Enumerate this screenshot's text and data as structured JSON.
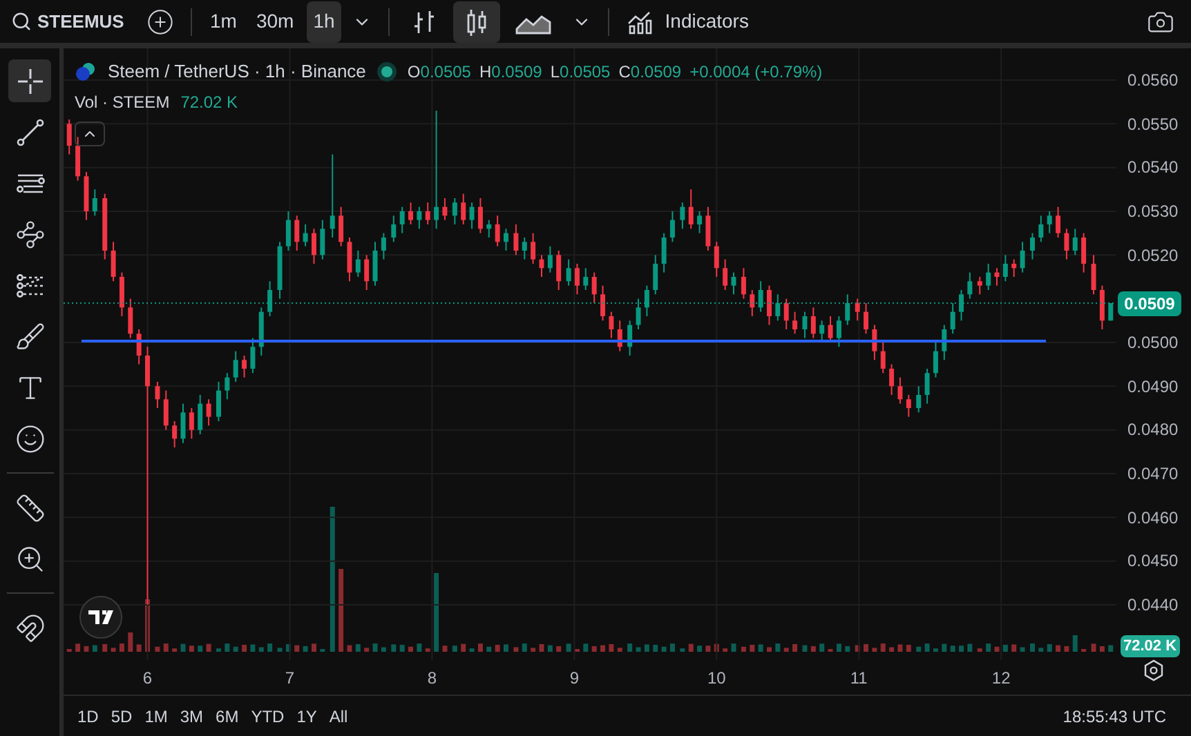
{
  "toolbar": {
    "symbol": "STEEMUS",
    "intervals": [
      {
        "label": "1m",
        "selected": false
      },
      {
        "label": "30m",
        "selected": false
      },
      {
        "label": "1h",
        "selected": true
      }
    ],
    "chart_styles": [
      {
        "kind": "bars",
        "selected": false
      },
      {
        "kind": "candles",
        "selected": true
      },
      {
        "kind": "area",
        "selected": false
      }
    ],
    "indicators_label": "Indicators"
  },
  "drawing_tools": [
    [
      {
        "kind": "crosshair",
        "selected": true
      },
      {
        "kind": "trend-line",
        "selected": false
      },
      {
        "kind": "fib",
        "selected": false
      },
      {
        "kind": "pattern",
        "selected": false
      },
      {
        "kind": "projection",
        "selected": false
      },
      {
        "kind": "brush",
        "selected": false
      },
      {
        "kind": "text",
        "selected": false
      },
      {
        "kind": "emoji",
        "selected": false
      }
    ],
    [
      {
        "kind": "ruler",
        "selected": false
      },
      {
        "kind": "zoom",
        "selected": false
      }
    ],
    [
      {
        "kind": "magnet",
        "selected": false
      }
    ]
  ],
  "legend": {
    "title": "Steem / TetherUS · 1h · Binance",
    "market_open": true,
    "ohlc": [
      {
        "key": "O",
        "value": "0.0505"
      },
      {
        "key": "H",
        "value": "0.0509"
      },
      {
        "key": "L",
        "value": "0.0505"
      },
      {
        "key": "C",
        "value": "0.0509"
      }
    ],
    "change": "+0.0004 (+0.79%)",
    "volume_label": "Vol · STEEM",
    "volume_value": "72.02 K"
  },
  "chart": {
    "chart_data": {
      "type": "candlestick",
      "x": [
        5.45,
        5.51,
        5.57,
        5.63,
        5.7,
        5.76,
        5.82,
        5.88,
        5.94,
        6.0,
        6.07,
        6.13,
        6.19,
        6.25,
        6.31,
        6.37,
        6.43,
        6.5,
        6.56,
        6.62,
        6.68,
        6.74,
        6.8,
        6.86,
        6.93,
        6.99,
        7.05,
        7.11,
        7.17,
        7.23,
        7.3,
        7.36,
        7.42,
        7.48,
        7.54,
        7.6,
        7.66,
        7.73,
        7.79,
        7.85,
        7.91,
        7.97,
        8.03,
        8.09,
        8.16,
        8.22,
        8.28,
        8.34,
        8.4,
        8.46,
        8.52,
        8.59,
        8.65,
        8.71,
        8.77,
        8.83,
        8.89,
        8.96,
        9.02,
        9.08,
        9.14,
        9.2,
        9.26,
        9.32,
        9.39,
        9.45,
        9.51,
        9.57,
        9.63,
        9.69,
        9.76,
        9.82,
        9.88,
        9.94,
        10.0,
        10.06,
        10.12,
        10.19,
        10.25,
        10.31,
        10.37,
        10.43,
        10.49,
        10.55,
        10.62,
        10.68,
        10.74,
        10.8,
        10.86,
        10.92,
        10.99,
        11.05,
        11.11,
        11.17,
        11.23,
        11.29,
        11.35,
        11.42,
        11.48,
        11.54,
        11.6,
        11.66,
        11.72,
        11.78,
        11.85,
        11.91,
        11.97,
        12.03,
        12.09,
        12.15,
        12.22,
        12.28,
        12.34,
        12.4,
        12.46,
        12.52,
        12.58,
        12.65,
        12.71,
        12.77
      ],
      "ohlc": [
        [
          0.055,
          0.0551,
          0.0543,
          0.0545
        ],
        [
          0.0545,
          0.0547,
          0.0537,
          0.0538
        ],
        [
          0.0538,
          0.0539,
          0.0528,
          0.053
        ],
        [
          0.053,
          0.0535,
          0.0529,
          0.0533
        ],
        [
          0.0533,
          0.0534,
          0.0519,
          0.0521
        ],
        [
          0.0521,
          0.0523,
          0.0514,
          0.0515
        ],
        [
          0.0515,
          0.0516,
          0.0506,
          0.0508
        ],
        [
          0.0508,
          0.051,
          0.0501,
          0.0502
        ],
        [
          0.0502,
          0.0503,
          0.0495,
          0.0497
        ],
        [
          0.0497,
          0.0499,
          0.044,
          0.049
        ],
        [
          0.049,
          0.0491,
          0.0485,
          0.0487
        ],
        [
          0.0487,
          0.0489,
          0.048,
          0.0481
        ],
        [
          0.0481,
          0.0482,
          0.0476,
          0.0478
        ],
        [
          0.0478,
          0.0486,
          0.0477,
          0.0484
        ],
        [
          0.0484,
          0.0485,
          0.0478,
          0.048
        ],
        [
          0.048,
          0.0488,
          0.0479,
          0.0486
        ],
        [
          0.0486,
          0.0487,
          0.0481,
          0.0483
        ],
        [
          0.0483,
          0.0491,
          0.0482,
          0.0489
        ],
        [
          0.0489,
          0.0493,
          0.0487,
          0.0492
        ],
        [
          0.0492,
          0.0498,
          0.0491,
          0.0496
        ],
        [
          0.0496,
          0.0497,
          0.0492,
          0.0494
        ],
        [
          0.0494,
          0.0501,
          0.0493,
          0.0499
        ],
        [
          0.0499,
          0.0508,
          0.0497,
          0.0507
        ],
        [
          0.0507,
          0.0514,
          0.0506,
          0.0512
        ],
        [
          0.0512,
          0.0523,
          0.051,
          0.0522
        ],
        [
          0.0522,
          0.053,
          0.0521,
          0.0528
        ],
        [
          0.0528,
          0.0529,
          0.0521,
          0.0523
        ],
        [
          0.0523,
          0.0527,
          0.0522,
          0.0525
        ],
        [
          0.0525,
          0.0526,
          0.0518,
          0.052
        ],
        [
          0.052,
          0.0528,
          0.0519,
          0.0526
        ],
        [
          0.0526,
          0.0543,
          0.0524,
          0.0529
        ],
        [
          0.0529,
          0.0531,
          0.0522,
          0.0523
        ],
        [
          0.0523,
          0.0524,
          0.0514,
          0.0516
        ],
        [
          0.0516,
          0.0521,
          0.0515,
          0.0519
        ],
        [
          0.0519,
          0.052,
          0.0512,
          0.0514
        ],
        [
          0.0514,
          0.0523,
          0.0513,
          0.0521
        ],
        [
          0.0521,
          0.0525,
          0.0519,
          0.0524
        ],
        [
          0.0524,
          0.0529,
          0.0523,
          0.0527
        ],
        [
          0.0527,
          0.0531,
          0.0525,
          0.053
        ],
        [
          0.053,
          0.0532,
          0.0527,
          0.0528
        ],
        [
          0.0528,
          0.0531,
          0.0526,
          0.053
        ],
        [
          0.053,
          0.0532,
          0.0527,
          0.0528
        ],
        [
          0.0528,
          0.0553,
          0.0526,
          0.0531
        ],
        [
          0.0531,
          0.0533,
          0.0528,
          0.0529
        ],
        [
          0.0529,
          0.0533,
          0.0527,
          0.0532
        ],
        [
          0.0532,
          0.0534,
          0.0527,
          0.0528
        ],
        [
          0.0528,
          0.0532,
          0.0526,
          0.0531
        ],
        [
          0.0531,
          0.0533,
          0.0525,
          0.0526
        ],
        [
          0.0526,
          0.0528,
          0.0524,
          0.0527
        ],
        [
          0.0527,
          0.0529,
          0.0522,
          0.0523
        ],
        [
          0.0523,
          0.0526,
          0.0521,
          0.0525
        ],
        [
          0.0525,
          0.0527,
          0.052,
          0.0521
        ],
        [
          0.0521,
          0.0524,
          0.0519,
          0.0523
        ],
        [
          0.0523,
          0.0525,
          0.0518,
          0.0519
        ],
        [
          0.0519,
          0.052,
          0.0515,
          0.0517
        ],
        [
          0.0517,
          0.0522,
          0.0516,
          0.052
        ],
        [
          0.052,
          0.0521,
          0.0512,
          0.0514
        ],
        [
          0.0514,
          0.0519,
          0.0513,
          0.0517
        ],
        [
          0.0517,
          0.0518,
          0.0511,
          0.0513
        ],
        [
          0.0513,
          0.0517,
          0.0512,
          0.0515
        ],
        [
          0.0515,
          0.0516,
          0.0509,
          0.0511
        ],
        [
          0.0511,
          0.0513,
          0.0505,
          0.0506
        ],
        [
          0.0506,
          0.0507,
          0.0501,
          0.0503
        ],
        [
          0.0503,
          0.0505,
          0.0498,
          0.0499
        ],
        [
          0.0499,
          0.0505,
          0.0497,
          0.0504
        ],
        [
          0.0504,
          0.051,
          0.0503,
          0.0508
        ],
        [
          0.0508,
          0.0513,
          0.0506,
          0.0512
        ],
        [
          0.0512,
          0.052,
          0.0511,
          0.0518
        ],
        [
          0.0518,
          0.0525,
          0.0516,
          0.0524
        ],
        [
          0.0524,
          0.053,
          0.0523,
          0.0528
        ],
        [
          0.0528,
          0.0532,
          0.0526,
          0.0531
        ],
        [
          0.0531,
          0.0535,
          0.0526,
          0.0527
        ],
        [
          0.0527,
          0.053,
          0.0525,
          0.0529
        ],
        [
          0.0529,
          0.0531,
          0.0521,
          0.0522
        ],
        [
          0.0522,
          0.0523,
          0.0515,
          0.0517
        ],
        [
          0.0517,
          0.0519,
          0.0512,
          0.0513
        ],
        [
          0.0513,
          0.0516,
          0.0511,
          0.0515
        ],
        [
          0.0515,
          0.0517,
          0.051,
          0.0511
        ],
        [
          0.0511,
          0.0512,
          0.0506,
          0.0508
        ],
        [
          0.0508,
          0.0514,
          0.0507,
          0.0512
        ],
        [
          0.0512,
          0.0513,
          0.0504,
          0.0506
        ],
        [
          0.0506,
          0.0511,
          0.0505,
          0.0509
        ],
        [
          0.0509,
          0.051,
          0.0503,
          0.0505
        ],
        [
          0.0505,
          0.0507,
          0.0502,
          0.0503
        ],
        [
          0.0503,
          0.0507,
          0.0501,
          0.0506
        ],
        [
          0.0506,
          0.0508,
          0.0501,
          0.0502
        ],
        [
          0.0502,
          0.0505,
          0.05,
          0.0504
        ],
        [
          0.0504,
          0.0506,
          0.05,
          0.0501
        ],
        [
          0.0501,
          0.0506,
          0.0499,
          0.0505
        ],
        [
          0.0505,
          0.0511,
          0.0504,
          0.0509
        ],
        [
          0.0509,
          0.051,
          0.0505,
          0.0507
        ],
        [
          0.0507,
          0.0509,
          0.0502,
          0.0503
        ],
        [
          0.0503,
          0.0504,
          0.0496,
          0.0498
        ],
        [
          0.0498,
          0.05,
          0.0493,
          0.0494
        ],
        [
          0.0494,
          0.0495,
          0.0488,
          0.049
        ],
        [
          0.049,
          0.0492,
          0.0486,
          0.0487
        ],
        [
          0.0487,
          0.0488,
          0.0483,
          0.0485
        ],
        [
          0.0485,
          0.049,
          0.0484,
          0.0488
        ],
        [
          0.0488,
          0.0494,
          0.0486,
          0.0493
        ],
        [
          0.0493,
          0.05,
          0.0492,
          0.0498
        ],
        [
          0.0498,
          0.0504,
          0.0496,
          0.0503
        ],
        [
          0.0503,
          0.0509,
          0.0502,
          0.0507
        ],
        [
          0.0507,
          0.0512,
          0.0505,
          0.0511
        ],
        [
          0.0511,
          0.0516,
          0.051,
          0.0514
        ],
        [
          0.0514,
          0.0515,
          0.0511,
          0.0513
        ],
        [
          0.0513,
          0.0518,
          0.0512,
          0.0516
        ],
        [
          0.0516,
          0.0517,
          0.0513,
          0.0515
        ],
        [
          0.0515,
          0.052,
          0.0514,
          0.0518
        ],
        [
          0.0518,
          0.0519,
          0.0515,
          0.0517
        ],
        [
          0.0517,
          0.0523,
          0.0516,
          0.0521
        ],
        [
          0.0521,
          0.0525,
          0.0519,
          0.0524
        ],
        [
          0.0524,
          0.0529,
          0.0523,
          0.0527
        ],
        [
          0.0527,
          0.053,
          0.0525,
          0.0529
        ],
        [
          0.0529,
          0.0531,
          0.0524,
          0.0525
        ],
        [
          0.0525,
          0.0526,
          0.0519,
          0.0521
        ],
        [
          0.0521,
          0.0526,
          0.052,
          0.0524
        ],
        [
          0.0524,
          0.0525,
          0.0516,
          0.0518
        ],
        [
          0.0518,
          0.052,
          0.0511,
          0.0512
        ],
        [
          0.0512,
          0.0513,
          0.0503,
          0.0505
        ],
        [
          0.0505,
          0.0509,
          0.0505,
          0.0509
        ]
      ],
      "xlim": [
        5.41,
        12.81
      ],
      "ylim": [
        0.044,
        0.056
      ],
      "grid": true,
      "xticks": [
        6,
        7,
        8,
        9,
        10,
        11,
        12
      ],
      "yticks": [
        {
          "value": 0.056,
          "label": "0.0560"
        },
        {
          "value": 0.055,
          "label": "0.0550"
        },
        {
          "value": 0.054,
          "label": "0.0540"
        },
        {
          "value": 0.053,
          "label": "0.0530"
        },
        {
          "value": 0.052,
          "label": "0.0520"
        },
        {
          "value": 0.05,
          "label": "0.0500"
        },
        {
          "value": 0.049,
          "label": "0.0490"
        },
        {
          "value": 0.048,
          "label": "0.0480"
        },
        {
          "value": 0.047,
          "label": "0.0470"
        },
        {
          "value": 0.046,
          "label": "0.0460"
        },
        {
          "value": 0.045,
          "label": "0.0450"
        },
        {
          "value": 0.044,
          "label": "0.0440"
        }
      ]
    },
    "last_price": "0.0509",
    "last_volume": "72.02 K"
  },
  "range_buttons": [
    "1D",
    "5D",
    "1M",
    "3M",
    "6M",
    "YTD",
    "1Y",
    "All"
  ],
  "clock": "18:55:43 UTC"
}
